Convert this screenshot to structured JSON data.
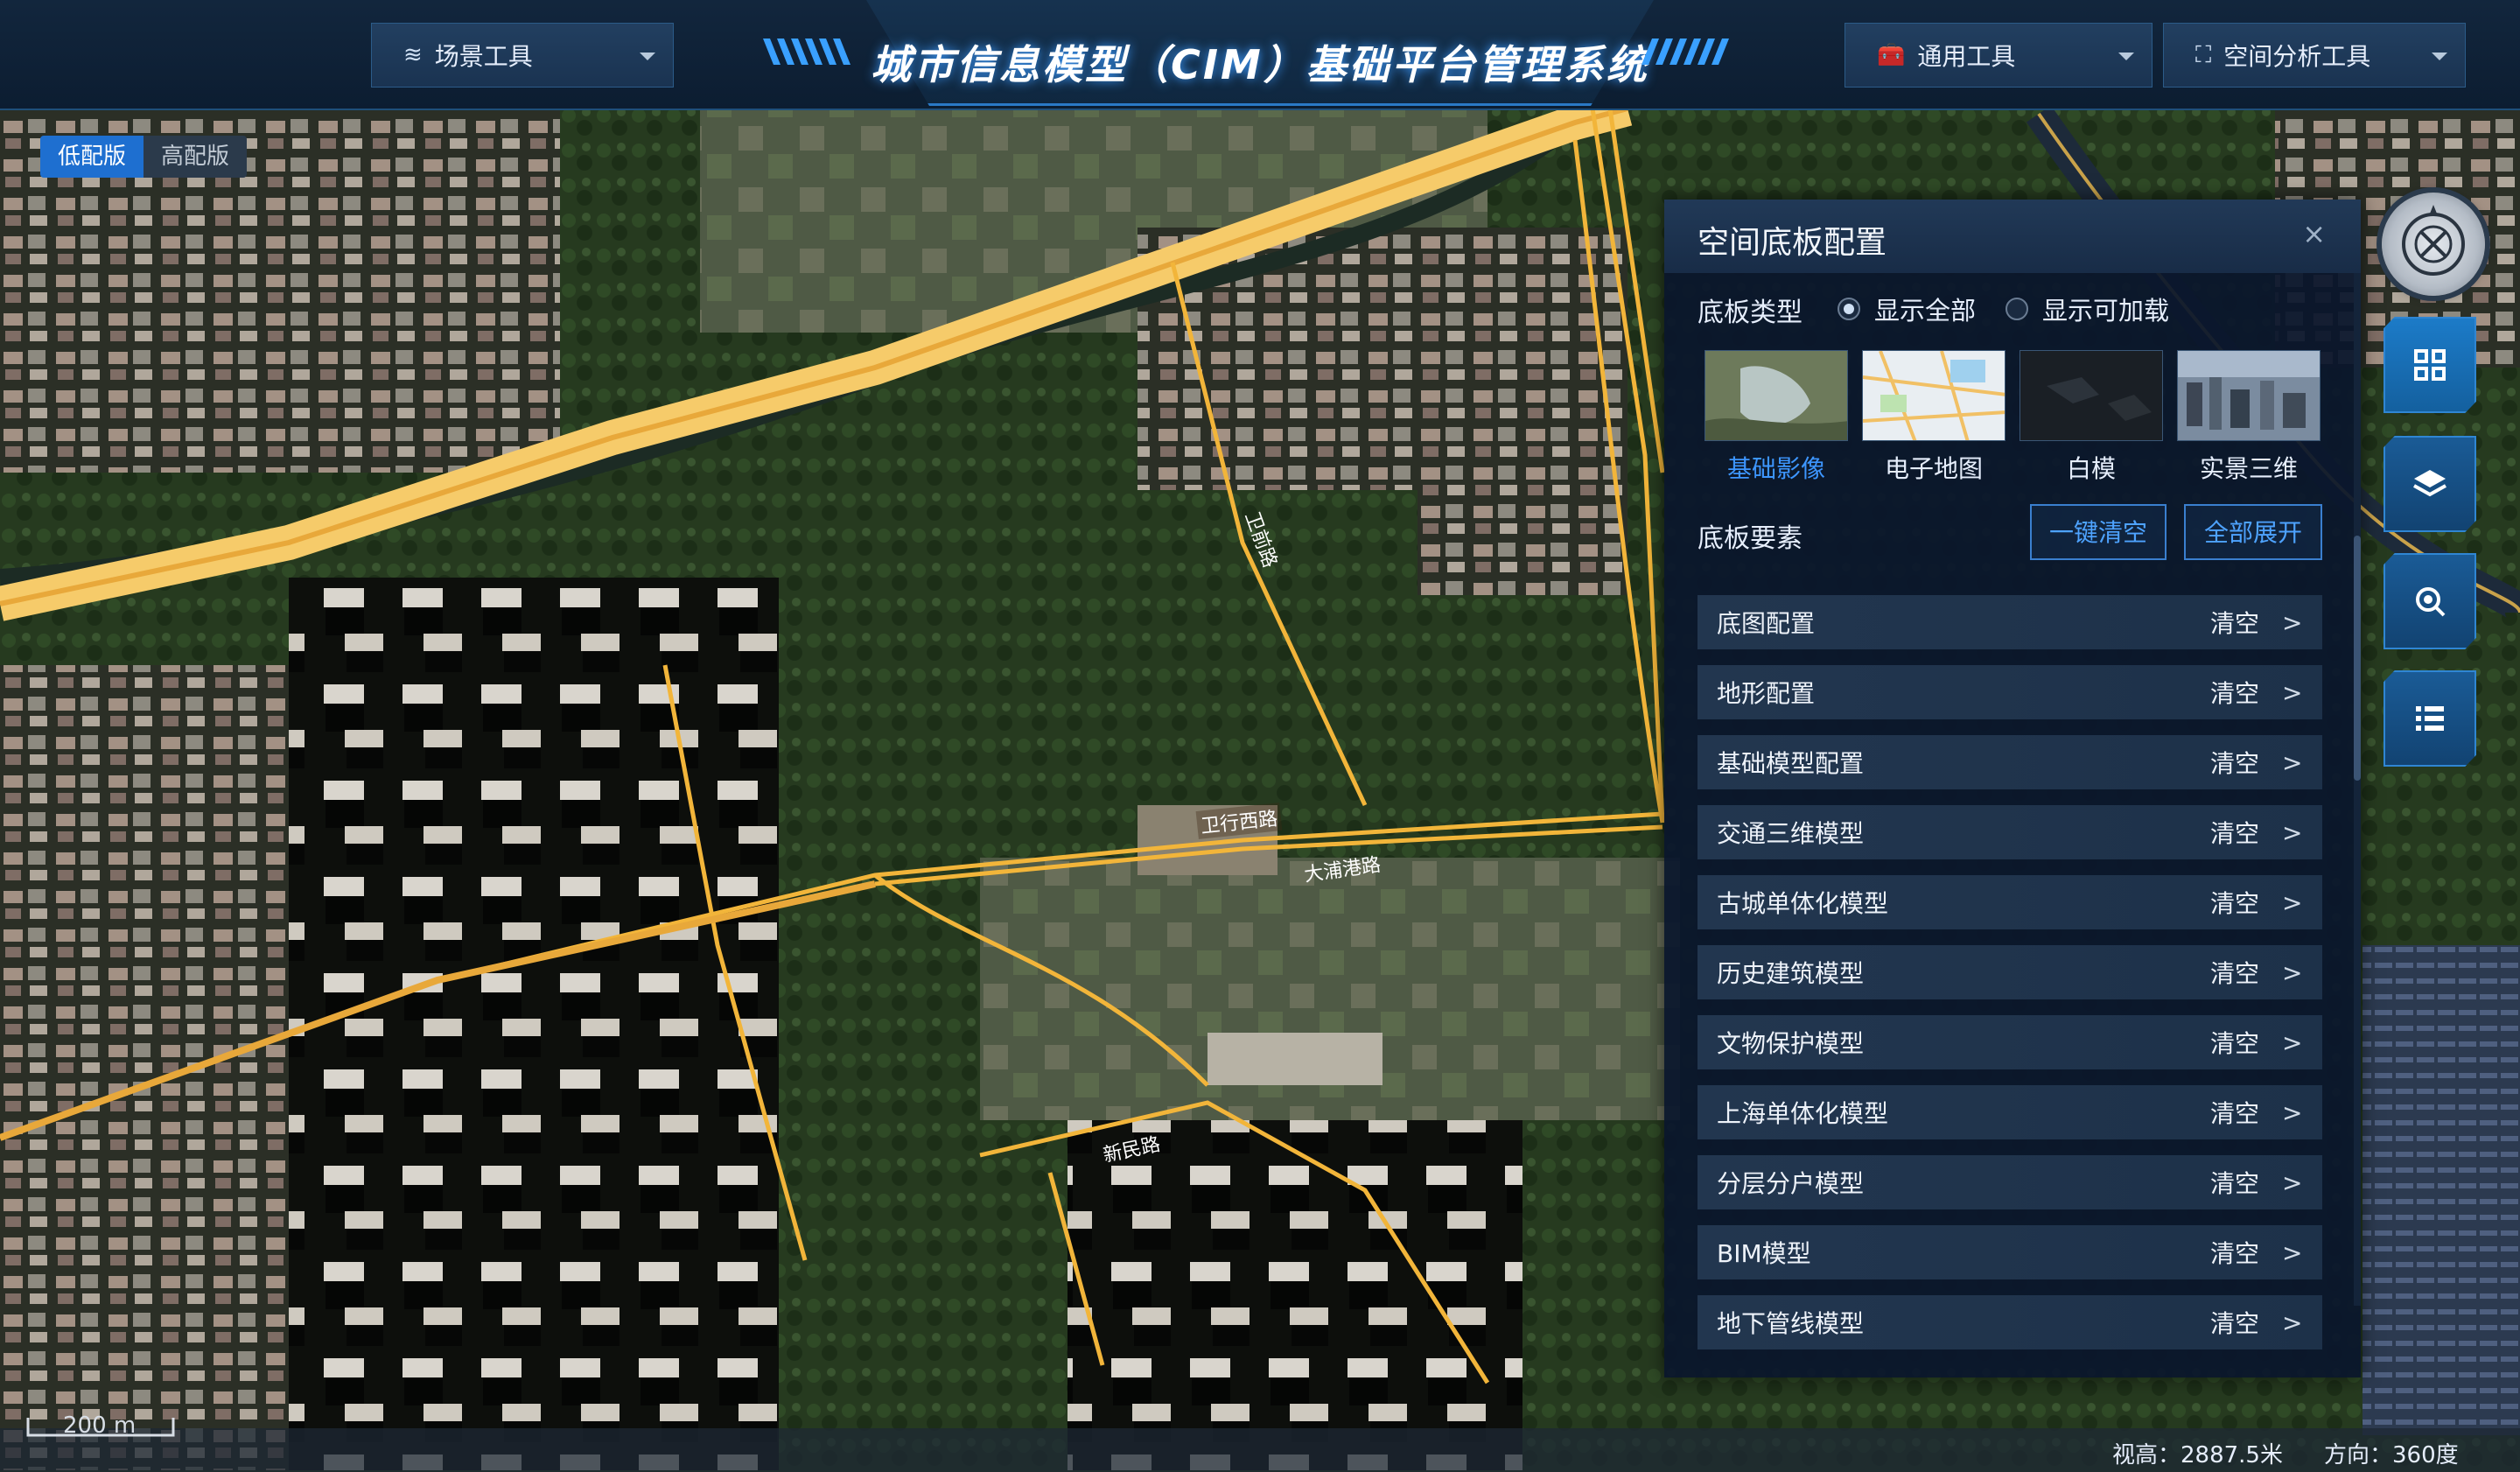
{
  "header": {
    "title": "城市信息模型（CIM）基础平台管理系统",
    "scene_tools": "场景工具",
    "general_tools": "通用工具",
    "spatial_tools": "空间分析工具"
  },
  "version": {
    "low": "低配版",
    "high": "高配版",
    "active": "低配版"
  },
  "map_labels": [
    "卫行西路",
    "大浦港路",
    "卫前路",
    "新民路"
  ],
  "panel": {
    "title": "空间底板配置",
    "close": "×",
    "type_label": "底板类型",
    "radio_all": "显示全部",
    "radio_loadable": "显示可加载",
    "selected_radio": "显示全部",
    "basemaps": [
      {
        "label": "基础影像",
        "icon": "satellite-thumbnail",
        "active": true
      },
      {
        "label": "电子地图",
        "icon": "street-map-thumbnail",
        "active": false
      },
      {
        "label": "白模",
        "icon": "white-model-thumbnail",
        "active": false
      },
      {
        "label": "实景三维",
        "icon": "realistic-3d-thumbnail",
        "active": false
      }
    ],
    "elements_label": "底板要素",
    "clear_all": "一键清空",
    "expand_all": "全部展开",
    "rows": [
      {
        "label": "底图配置",
        "clear": "清空",
        "arrow": ">"
      },
      {
        "label": "地形配置",
        "clear": "清空",
        "arrow": ">"
      },
      {
        "label": "基础模型配置",
        "clear": "清空",
        "arrow": ">"
      },
      {
        "label": "交通三维模型",
        "clear": "清空",
        "arrow": ">"
      },
      {
        "label": "古城单体化模型",
        "clear": "清空",
        "arrow": ">"
      },
      {
        "label": "历史建筑模型",
        "clear": "清空",
        "arrow": ">"
      },
      {
        "label": "文物保护模型",
        "clear": "清空",
        "arrow": ">"
      },
      {
        "label": "上海单体化模型",
        "clear": "清空",
        "arrow": ">"
      },
      {
        "label": "分层分户模型",
        "clear": "清空",
        "arrow": ">"
      },
      {
        "label": "BIM模型",
        "clear": "清空",
        "arrow": ">"
      },
      {
        "label": "地下管线模型",
        "clear": "清空",
        "arrow": ">"
      }
    ]
  },
  "sidebar_icons": [
    "compass-icon",
    "grid-icon",
    "layers-icon",
    "search-icon",
    "list-icon"
  ],
  "status": {
    "scale": "200 m",
    "height": "视高：2887.5米",
    "direction": "方向：360度"
  },
  "colors": {
    "accent": "#1e6fd0",
    "road": "#f2b53a",
    "panel_bg": "#0a162c",
    "active_label": "#3d96ff"
  }
}
